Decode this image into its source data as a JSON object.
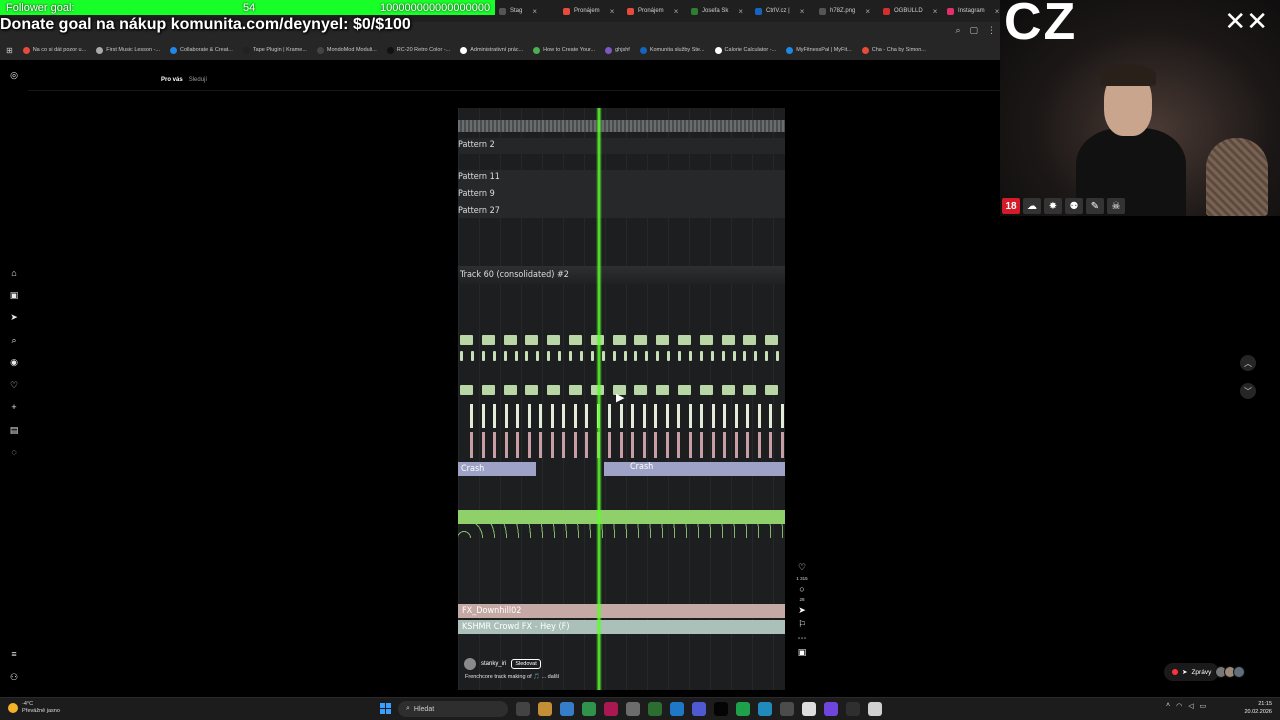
{
  "overlay": {
    "follower_label": "Follower goal:",
    "follower_count": "54",
    "follower_target": "100000000000000000",
    "donate_text": "Donate goal na nákup komunita.com/deynyel: $0/$100",
    "channel_tag": "CZ",
    "mark": "✕✕"
  },
  "browser": {
    "tabs": [
      {
        "title": "Stag",
        "color": "#555"
      },
      {
        "title": "Pronájem",
        "color": "#e84b3c"
      },
      {
        "title": "Pronájem",
        "color": "#e84b3c"
      },
      {
        "title": "Josefa Sk",
        "color": "#2e7d32"
      },
      {
        "title": "CtrlV.cz |",
        "color": "#1565c0"
      },
      {
        "title": "h78Z.png",
        "color": "#555"
      },
      {
        "title": "OGBULLD",
        "color": "#d32f2f"
      },
      {
        "title": "Instagram",
        "color": "#e1306c"
      },
      {
        "title": "(",
        "color": "#e1306c"
      }
    ],
    "bookmarks": [
      {
        "title": "Na co si dát pozor u...",
        "color": "#e84b3c"
      },
      {
        "title": "First Music Lesson -...",
        "color": "#aaa"
      },
      {
        "title": "Collaborate & Creat...",
        "color": "#1e88e5"
      },
      {
        "title": "Tape Plugin | Krame...",
        "color": "#222"
      },
      {
        "title": "MondoMod Moduli...",
        "color": "#444"
      },
      {
        "title": "RC-20 Retro Color -...",
        "color": "#111"
      },
      {
        "title": "Administrativní prác...",
        "color": "#fff"
      },
      {
        "title": "How to Create Your...",
        "color": "#4caf50"
      },
      {
        "title": "ghjshf",
        "color": "#7e57c2"
      },
      {
        "title": "Komunita služby Ste...",
        "color": "#1565c0"
      },
      {
        "title": "Calorie Calculator -...",
        "color": "#fff"
      },
      {
        "title": "MyFitnessPal | MyFit...",
        "color": "#1e88e5"
      },
      {
        "title": "Cha - Cha by Simon...",
        "color": "#e84b3c"
      }
    ]
  },
  "instagram": {
    "tab_for_you": "Pro vás",
    "tab_following": "Sledují",
    "author": "stanky_iri",
    "follow_label": "Sledovat",
    "caption": "Frenchcore track making of 🎵 ... další",
    "likes": "1 315",
    "comments": "28",
    "messages_label": "Zprávy"
  },
  "video": {
    "labels": [
      {
        "text": "Pattern 2"
      },
      {
        "text": "Pattern 11"
      },
      {
        "text": "Pattern 9"
      },
      {
        "text": "Pattern 27"
      },
      {
        "text": "Track 60 (consolidated) #2"
      },
      {
        "text": "Crash"
      },
      {
        "text": "Crash"
      },
      {
        "text": "FX_Downhill02"
      },
      {
        "text": "KSHMR Crowd FX - Hey (F)"
      }
    ]
  },
  "taskbar": {
    "temp": "-4°C",
    "weather": "Převážně jasno",
    "search_placeholder": "Hledat",
    "time": "21:15",
    "date": "20.02.2026"
  },
  "colors": {
    "follower_bar": "#18ff28",
    "playhead": "#5aff2a",
    "notes": "#b9d6a6"
  }
}
